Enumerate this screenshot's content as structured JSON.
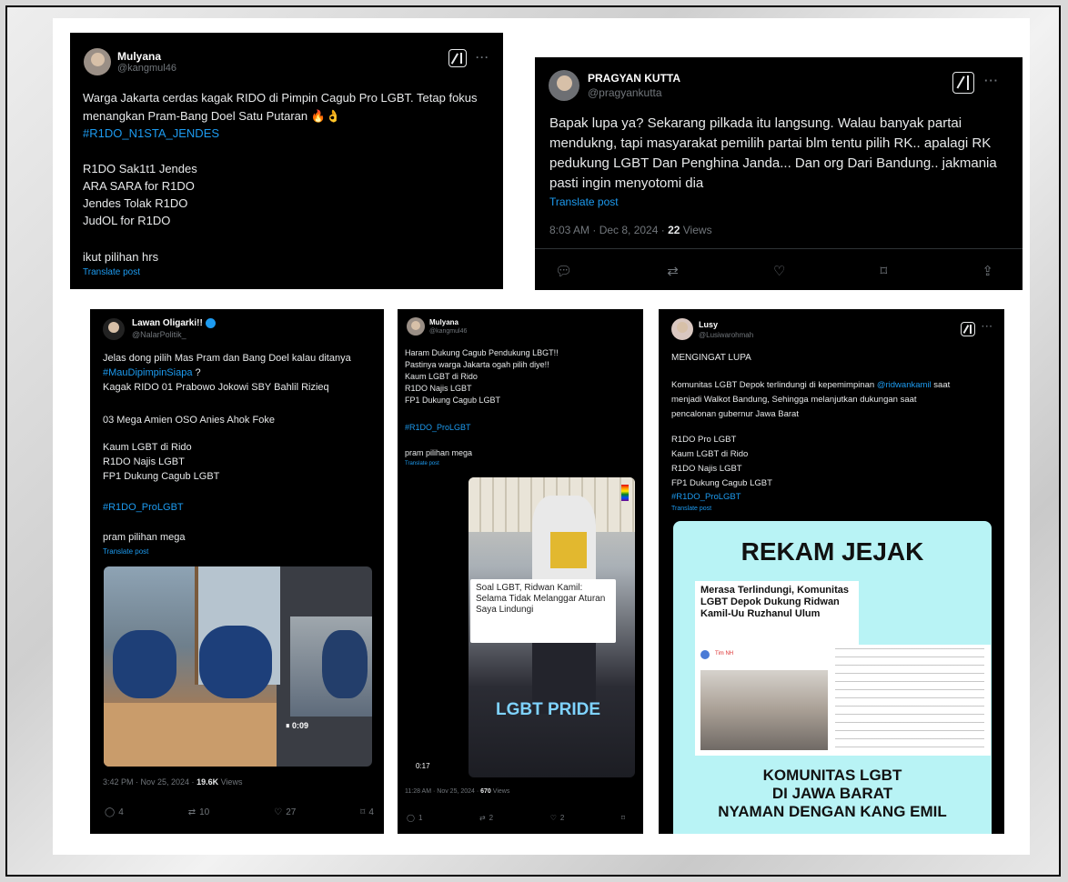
{
  "card1": {
    "name": "Mulyana",
    "handle": "@kangmul46",
    "lines": [
      "Warga Jakarta cerdas kagak RIDO di Pimpin Cagub Pro LGBT. Tetap fokus",
      "menangkan Pram-Bang Doel Satu Putaran 🔥👌"
    ],
    "hashtag": "#R1DO_N1STA_JENDES",
    "list": [
      "R1DO Sak1t1 Jendes",
      "ARA SARA for R1DO",
      "Jendes Tolak R1DO",
      "JudOL for R1DO"
    ],
    "closing": "ikut pilihan hrs",
    "translate": "Translate post"
  },
  "card2": {
    "name": "PRAGYAN KUTTA",
    "handle": "@pragyankutta",
    "lines": [
      "Bapak lupa ya? Sekarang pilkada itu langsung. Walau banyak partai",
      "mendukng, tapi masyarakat pemilih partai blm tentu pilih RK.. apalagi RK",
      "pedukung LGBT Dan Penghina Janda... Dan org Dari Bandung.. jakmania",
      "pasti ingin menyotomi dia"
    ],
    "translate": "Translate post",
    "time": "8:03 AM · Dec 8, 2024 · ",
    "views_count": "22",
    "views_label": " Views"
  },
  "card3": {
    "name": "Lawan Oligarki!!",
    "handle": "@NalarPolitik_",
    "line1": "Jelas dong pilih Mas Pram dan Bang Doel kalau ditanya",
    "hashtag1": "#MauDipimpinSiapa",
    "hashtag1_suffix": " ?",
    "line2": "Kagak RIDO 01 Prabowo Jokowi SBY Bahlil Rizieq",
    "line3": "03 Mega Amien OSO Anies Ahok Foke",
    "list": [
      "Kaum LGBT di Rido",
      "R1DO Najis LGBT",
      "FP1 Dukung Cagub LGBT"
    ],
    "hashtag2": "#R1DO_ProLGBT",
    "closing": "pram pilihan mega",
    "translate": "Translate post",
    "video_time": "⏸ 0:09",
    "time": "3:42 PM · Nov 25, 2024 · ",
    "views_count": "19.6K",
    "views_label": " Views",
    "replies": "4",
    "reposts": "10",
    "likes": "27",
    "bookmarks": "4"
  },
  "card4": {
    "name": "Mulyana",
    "handle": "@kangmul46",
    "lines": [
      "Haram Dukung Cagub Pendukung LBGT!!",
      "Pastinya warga Jakarta ogah pilih diye!!",
      "Kaum LGBT di Rido",
      "R1DO Najis LGBT",
      "FP1 Dukung Cagub LGBT"
    ],
    "hashtag": "#R1DO_ProLGBT",
    "closing": "pram pilihan mega",
    "translate": "Translate post",
    "news_caption": "Soal LGBT, Ridwan Kamil: Selama Tidak Melanggar Aturan Saya Lindungi",
    "pride_text": "LGBT PRIDE",
    "video_time": "0:17",
    "time": "11:28 AM · Nov 25, 2024 · ",
    "views_count": "670",
    "views_label": " Views",
    "replies": "1",
    "reposts": "2",
    "likes": "2"
  },
  "card5": {
    "name": "Lusy",
    "handle": "@Lusiwarohmah",
    "title_line": "MENGINGAT LUPA",
    "line1a": "Komunitas LGBT Depok terlindungi di kepemimpinan ",
    "mention": "@ridwankamil",
    "line1b": " saat",
    "line2": "menjadi Walkot Bandung, Sehingga melanjutkan dukungan saat",
    "line3": "pencalonan gubernur Jawa Barat",
    "list": [
      "R1DO Pro LGBT",
      "Kaum LGBT di Rido",
      "R1DO Najis LGBT",
      "FP1 Dukung Cagub LGBT"
    ],
    "hashtag": "#R1DO_ProLGBT",
    "translate": "Translate post",
    "poster_title": "REKAM JEJAK",
    "article_title": "Merasa Terlindungi, Komunitas LGBT Depok Dukung Ridwan Kamil-Uu Ruzhanul Ulum",
    "article_author": "Tim NH",
    "poster_footer": [
      "KOMUNITAS LGBT",
      "DI JAWA BARAT",
      "NYAMAN DENGAN KANG EMIL"
    ]
  },
  "colors": {
    "card_bg": "#000000",
    "text": "#e7e9ea",
    "muted": "#71767b",
    "link": "#1d9bf0",
    "poster_bg": "#b8f3f5"
  }
}
